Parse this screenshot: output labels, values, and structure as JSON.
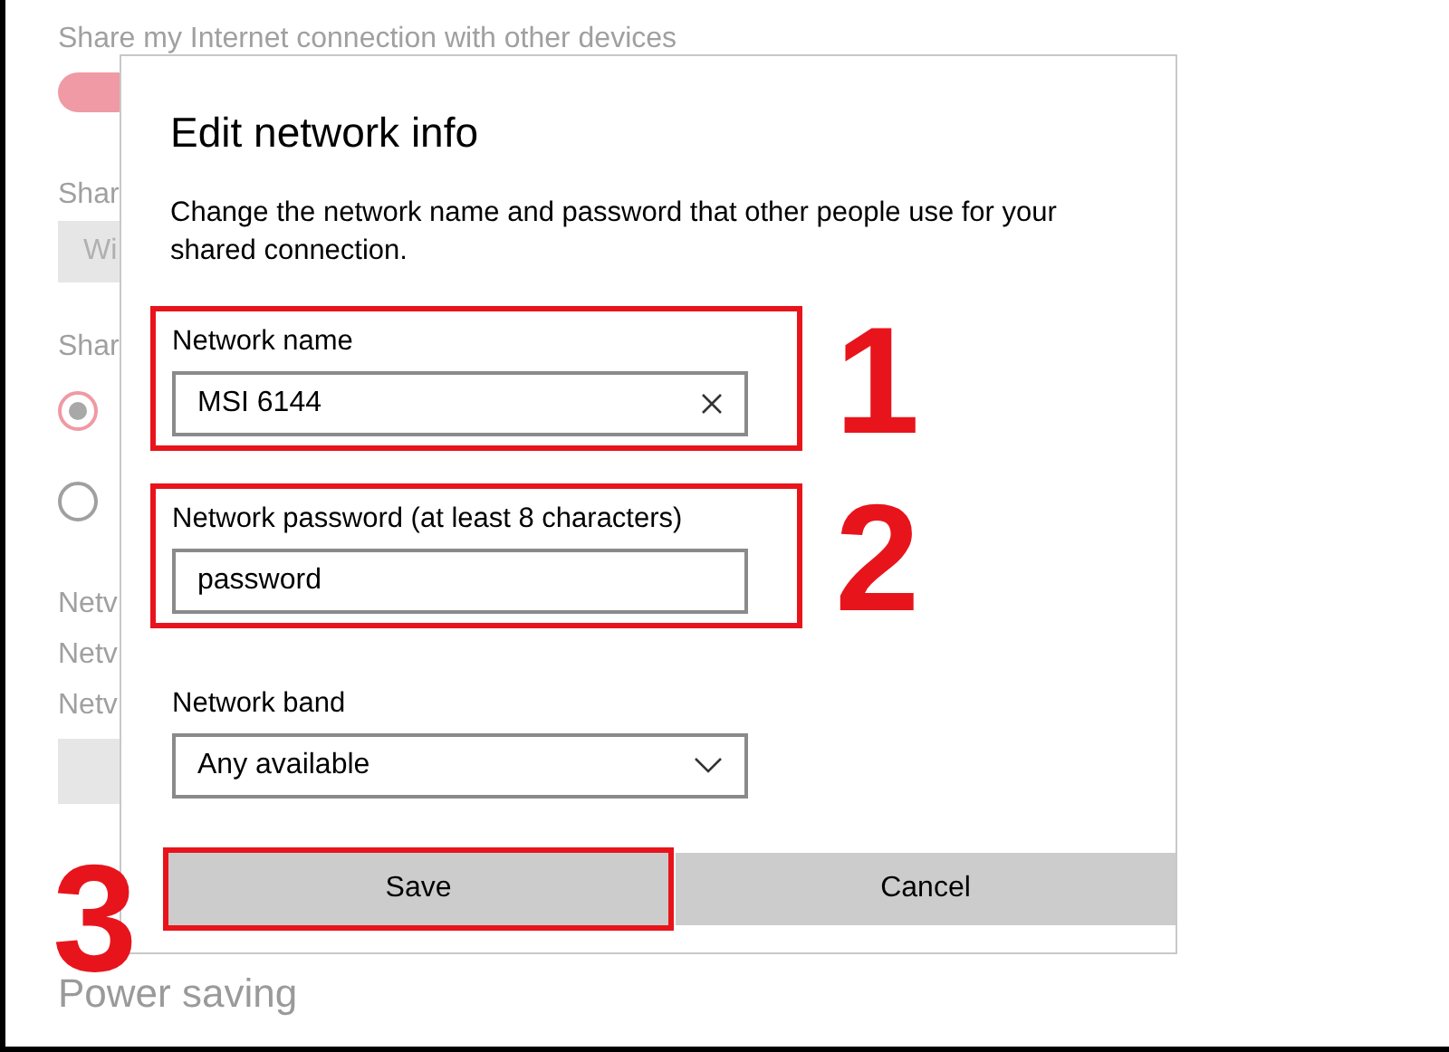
{
  "settings": {
    "share_heading": "Share my Internet connection with other devices",
    "share_toggle": {
      "on": true
    },
    "share_from_label": "Shar",
    "share_from_dropdown": {
      "value": "Wi"
    },
    "share_over_label": "Shar",
    "share_over_options": [
      {
        "selected": true
      },
      {
        "selected": false
      }
    ],
    "network_lines": [
      "Netv",
      "Netv",
      "Netv"
    ],
    "power_saving_heading": "Power saving"
  },
  "dialog": {
    "title": "Edit network info",
    "description": "Change the network name and password that other people use for your shared connection.",
    "fields": [
      {
        "kind": "text",
        "label": "Network name",
        "value": "MSI 6144",
        "step": "1"
      },
      {
        "kind": "password",
        "label": "Network password (at least 8 characters)",
        "value": "password",
        "step": "2"
      },
      {
        "kind": "dropdown",
        "label": "Network band",
        "value": "Any available"
      }
    ],
    "buttons": [
      {
        "label": "Save",
        "step": "3"
      },
      {
        "label": "Cancel"
      }
    ]
  }
}
